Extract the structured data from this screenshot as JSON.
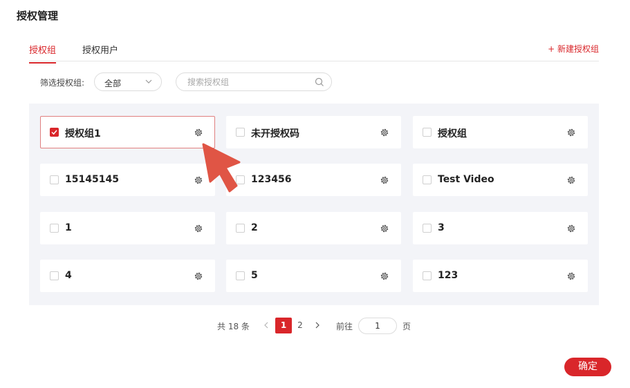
{
  "page": {
    "title": "授权管理"
  },
  "tabs": [
    {
      "label": "授权组",
      "active": true
    },
    {
      "label": "授权用户",
      "active": false
    }
  ],
  "new_group_label": "+ 新建授权组",
  "filter": {
    "label": "筛选授权组:",
    "select_value": "全部",
    "search_placeholder": "搜索授权组"
  },
  "groups": [
    {
      "label": "授权组1",
      "checked": true
    },
    {
      "label": "未开授权码",
      "checked": false
    },
    {
      "label": "授权组",
      "checked": false
    },
    {
      "label": "15145145",
      "checked": false
    },
    {
      "label": "123456",
      "checked": false
    },
    {
      "label": "Test Video",
      "checked": false
    },
    {
      "label": "1",
      "checked": false
    },
    {
      "label": "2",
      "checked": false
    },
    {
      "label": "3",
      "checked": false
    },
    {
      "label": "4",
      "checked": false
    },
    {
      "label": "5",
      "checked": false
    },
    {
      "label": "123",
      "checked": false
    }
  ],
  "pagination": {
    "total_text": "共 18 条",
    "pages": [
      "1",
      "2"
    ],
    "current": "1",
    "goto_label": "前往",
    "goto_value": "1",
    "goto_suffix": "页"
  },
  "confirm_label": "确定",
  "colors": {
    "accent": "#d9262a",
    "grid_bg": "#f3f4f8",
    "cursor": "#e05545"
  }
}
